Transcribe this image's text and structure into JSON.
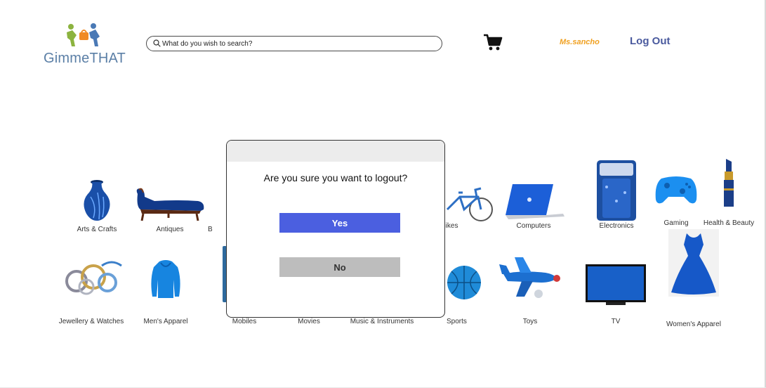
{
  "header": {
    "logo_text": "GimmeTHAT",
    "search_placeholder": "What do you wish to search?",
    "user_name": "Ms.sancho",
    "logout_label": "Log Out"
  },
  "categories": [
    {
      "label": "Arts & Crafts",
      "icon": "vase-icon"
    },
    {
      "label": "Antiques",
      "icon": "chaise-icon"
    },
    {
      "label": "B",
      "icon": "book-icon"
    },
    {
      "label": "Bikes",
      "icon": "bicycle-icon"
    },
    {
      "label": "Computers",
      "icon": "laptop-icon"
    },
    {
      "label": "Electronics",
      "icon": "washing-machine-icon"
    },
    {
      "label": "Gaming",
      "icon": "gamepad-icon"
    },
    {
      "label": "Health & Beauty",
      "icon": "lipstick-icon"
    },
    {
      "label": "Jewellery & Watches",
      "icon": "jewellery-icon"
    },
    {
      "label": "Men's Apparel",
      "icon": "hoodie-icon"
    },
    {
      "label": "Mobiles",
      "icon": "phone-icon"
    },
    {
      "label": "Movies",
      "icon": "film-icon"
    },
    {
      "label": "Music & Instruments",
      "icon": "music-icon"
    },
    {
      "label": "Sports",
      "icon": "ball-icon"
    },
    {
      "label": "Toys",
      "icon": "toy-plane-icon"
    },
    {
      "label": "TV",
      "icon": "tv-icon"
    },
    {
      "label": "Women's Apparel",
      "icon": "dress-icon"
    }
  ],
  "modal": {
    "question": "Are you sure you want to logout?",
    "yes_label": "Yes",
    "no_label": "No"
  },
  "colors": {
    "accent_blue": "#4b5fe0",
    "product_blue": "#1a6fd6",
    "username_orange": "#f0a020",
    "logout_navy": "#4a5a9e"
  }
}
